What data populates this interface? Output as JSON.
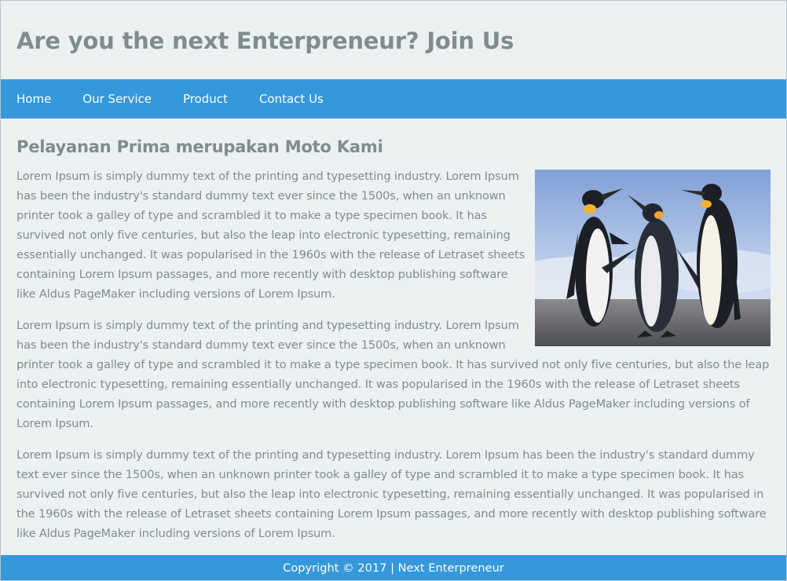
{
  "header": {
    "title": "Are you the next Enterpreneur? Join Us"
  },
  "nav": {
    "items": [
      {
        "label": "Home"
      },
      {
        "label": "Our Service"
      },
      {
        "label": "Product"
      },
      {
        "label": "Contact Us"
      }
    ]
  },
  "main": {
    "heading": "Pelayanan Prima merupakan Moto Kami",
    "image": {
      "subject": "penguins-photo"
    },
    "paragraphs": [
      "Lorem Ipsum is simply dummy text of the printing and typesetting industry. Lorem Ipsum has been the industry's standard dummy text ever since the 1500s, when an unknown printer took a galley of type and scrambled it to make a type specimen book. It has survived not only five centuries, but also the leap into electronic typesetting, remaining essentially unchanged. It was popularised in the 1960s with the release of Letraset sheets containing Lorem Ipsum passages, and more recently with desktop publishing software like Aldus PageMaker including versions of Lorem Ipsum.",
      "Lorem Ipsum is simply dummy text of the printing and typesetting industry. Lorem Ipsum has been the industry's standard dummy text ever since the 1500s, when an unknown printer took a galley of type and scrambled it to make a type specimen book. It has survived not only five centuries, but also the leap into electronic typesetting, remaining essentially unchanged. It was popularised in the 1960s with the release of Letraset sheets containing Lorem Ipsum passages, and more recently with desktop publishing software like Aldus PageMaker including versions of Lorem Ipsum.",
      "Lorem Ipsum is simply dummy text of the printing and typesetting industry. Lorem Ipsum has been the industry's standard dummy text ever since the 1500s, when an unknown printer took a galley of type and scrambled it to make a type specimen book. It has survived not only five centuries, but also the leap into electronic typesetting, remaining essentially unchanged. It was popularised in the 1960s with the release of Letraset sheets containing Lorem Ipsum passages, and more recently with desktop publishing software like Aldus PageMaker including versions of Lorem Ipsum."
    ]
  },
  "footer": {
    "text": "Copyright © 2017 | Next Enterpreneur"
  },
  "colors": {
    "accent": "#3498db",
    "background": "#ecf0f1",
    "text": "#7f8c8d",
    "nav_text": "#ffffff"
  }
}
